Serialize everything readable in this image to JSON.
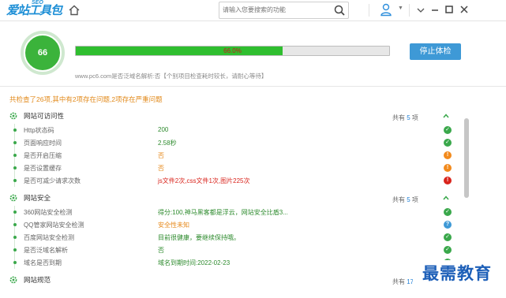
{
  "header": {
    "logo": "爱站工具包",
    "logo_sup": "SEO",
    "search_placeholder": "请输入您要搜索的功能"
  },
  "score": {
    "value": "66",
    "progress_text": "66.0%",
    "progress_fraction": 0.66,
    "stop_label": "停止体检",
    "note": "www.pc6.com是否泛域名解析:否【个别项目检查耗时较长，请耐心等待】"
  },
  "summary": "共检查了26项,其中有2项存在问题,2项存在严重问题",
  "colors": {
    "ok": "#3aa84b",
    "warn": "#f28a1c",
    "error": "#d9241c",
    "info": "#3e99d6",
    "green_text": "#2e8b2e",
    "orange_text": "#e6891b",
    "red_text": "#d9241c"
  },
  "sections": [
    {
      "title": "网站可访问性",
      "count_prefix": "共有",
      "count": "5",
      "count_suffix": "项",
      "rows": [
        {
          "label": "Http状态码",
          "value": "200",
          "tone": "green",
          "status": "ok"
        },
        {
          "label": "页面响应时间",
          "value": "2.58秒",
          "tone": "green",
          "status": "ok"
        },
        {
          "label": "是否开启压缩",
          "value": "否",
          "tone": "orange",
          "status": "warn"
        },
        {
          "label": "是否设置缓存",
          "value": "否",
          "tone": "orange",
          "status": "warn"
        },
        {
          "label": "是否可减少请求次数",
          "value": "js文件2次,css文件1次,图片225次",
          "tone": "red",
          "status": "error"
        }
      ]
    },
    {
      "title": "网站安全",
      "count_prefix": "共有",
      "count": "5",
      "count_suffix": "项",
      "rows": [
        {
          "label": "360网站安全检测",
          "value": "得分:100,神马黑客都是浮云，网站安全比盾3...",
          "tone": "green",
          "status": "ok"
        },
        {
          "label": "QQ管家网站安全检测",
          "value": "安全性未知",
          "tone": "orange",
          "status": "info"
        },
        {
          "label": "百度网站安全检测",
          "value": "目前很健康，要继续保持哦。",
          "tone": "green",
          "status": "ok"
        },
        {
          "label": "是否泛域名解析",
          "value": "否",
          "tone": "green",
          "status": "ok"
        },
        {
          "label": "域名是否到期",
          "value": "域名到期时间:2022-02-23",
          "tone": "green",
          "status": "ok"
        }
      ]
    },
    {
      "title": "网站规范",
      "count_prefix": "共有",
      "count": "17",
      "count_suffix": "项",
      "rows": []
    }
  ],
  "watermark": "最需教育"
}
